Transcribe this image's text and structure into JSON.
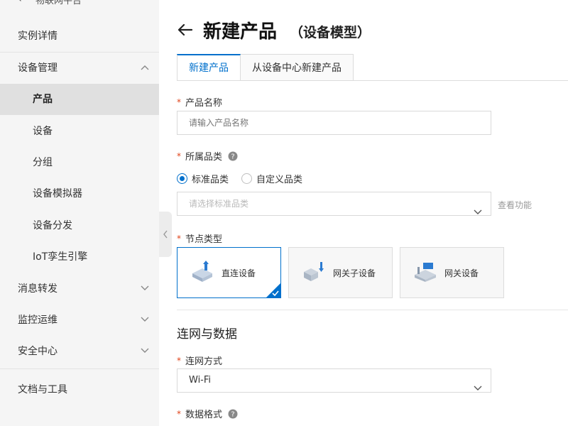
{
  "sidebar": {
    "top_cut_text": "物联网平台",
    "items": [
      {
        "label": "实例详情",
        "level": "top"
      },
      {
        "label": "设备管理",
        "level": "top",
        "chevron": "up"
      },
      {
        "label": "产品",
        "level": "sub",
        "active": true
      },
      {
        "label": "设备",
        "level": "sub"
      },
      {
        "label": "分组",
        "level": "sub"
      },
      {
        "label": "设备模拟器",
        "level": "sub"
      },
      {
        "label": "设备分发",
        "level": "sub"
      },
      {
        "label": "IoT孪生引擎",
        "level": "sub"
      },
      {
        "label": "消息转发",
        "level": "top",
        "chevron": "down"
      },
      {
        "label": "监控运维",
        "level": "top",
        "chevron": "down"
      },
      {
        "label": "安全中心",
        "level": "top",
        "chevron": "down"
      },
      {
        "label": "文档与工具",
        "level": "top"
      }
    ]
  },
  "header": {
    "title": "新建产品",
    "subtitle": "（设备模型）"
  },
  "tabs": [
    {
      "label": "新建产品",
      "active": true
    },
    {
      "label": "从设备中心新建产品",
      "active": false
    }
  ],
  "form": {
    "product_name": {
      "label": "产品名称",
      "placeholder": "请输入产品名称",
      "required": true
    },
    "category": {
      "label": "所属品类",
      "required": true,
      "options": [
        {
          "label": "标准品类",
          "selected": true
        },
        {
          "label": "自定义品类",
          "selected": false
        }
      ],
      "select_placeholder": "请选择标准品类",
      "view_function_link": "查看功能"
    },
    "node_type": {
      "label": "节点类型",
      "required": true,
      "cards": [
        {
          "label": "直连设备",
          "icon": "direct-device-icon",
          "selected": true
        },
        {
          "label": "网关子设备",
          "icon": "gateway-subdevice-icon",
          "selected": false
        },
        {
          "label": "网关设备",
          "icon": "gateway-device-icon",
          "selected": false
        }
      ]
    },
    "section_network": {
      "title": "连网与数据"
    },
    "network_method": {
      "label": "连网方式",
      "required": true,
      "value": "Wi-Fi"
    },
    "data_format": {
      "label": "数据格式",
      "required": true
    }
  },
  "colors": {
    "accent": "#0070cc",
    "required": "#e0431a",
    "sidebar_bg": "#f5f5f5",
    "sidebar_active": "#e0e0e0"
  }
}
